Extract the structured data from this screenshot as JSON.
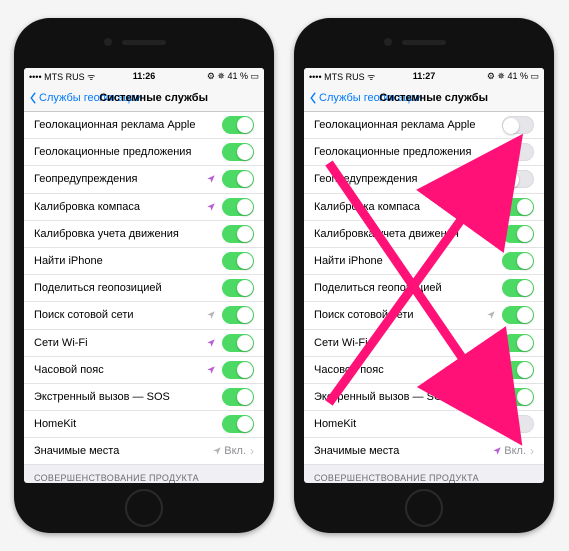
{
  "phones": [
    {
      "status": {
        "carrier": "MTS RUS",
        "sig_wifi": "📶",
        "time": "11:26",
        "bt": "⚡ ⁂",
        "battery": "41 %",
        "batt_icon": "▭"
      },
      "nav": {
        "back": "Службы геолокации",
        "title": "Системные службы"
      },
      "rows": [
        {
          "label": "Геолокационная реклама Apple",
          "toggle": true,
          "loc": null
        },
        {
          "label": "Геолокационные предложения",
          "toggle": true,
          "loc": null
        },
        {
          "label": "Геопредупреждения",
          "toggle": true,
          "loc": "purple"
        },
        {
          "label": "Калибровка компаса",
          "toggle": true,
          "loc": "purple"
        },
        {
          "label": "Калибровка учета движения",
          "toggle": true,
          "loc": null
        },
        {
          "label": "Найти iPhone",
          "toggle": true,
          "loc": null
        },
        {
          "label": "Поделиться геопозицией",
          "toggle": true,
          "loc": null
        },
        {
          "label": "Поиск сотовой сети",
          "toggle": true,
          "loc": "gray"
        },
        {
          "label": "Сети Wi-Fi",
          "toggle": true,
          "loc": "purple"
        },
        {
          "label": "Часовой пояс",
          "toggle": true,
          "loc": "purple"
        },
        {
          "label": "Экстренный вызов — SOS",
          "toggle": true,
          "loc": null
        },
        {
          "label": "HomeKit",
          "toggle": true,
          "loc": null
        }
      ],
      "link": {
        "label": "Значимые места",
        "value": "Вкл.",
        "loc": "gray"
      },
      "section": "СОВЕРШЕНСТВОВАНИЕ ПРОДУКТА"
    },
    {
      "status": {
        "carrier": "MTS RUS",
        "sig_wifi": "📶",
        "time": "11:27",
        "bt": "⚡ ⁂",
        "battery": "41 %",
        "batt_icon": "▭"
      },
      "nav": {
        "back": "Службы геолокации",
        "title": "Системные службы"
      },
      "rows": [
        {
          "label": "Геолокационная реклама Apple",
          "toggle": false,
          "loc": null
        },
        {
          "label": "Геолокационные предложения",
          "toggle": false,
          "loc": null
        },
        {
          "label": "Геопредупреждения",
          "toggle": false,
          "loc": "purple"
        },
        {
          "label": "Калибровка компаса",
          "toggle": true,
          "loc": "purple"
        },
        {
          "label": "Калибровка учета движения",
          "toggle": true,
          "loc": null
        },
        {
          "label": "Найти iPhone",
          "toggle": true,
          "loc": null
        },
        {
          "label": "Поделиться геопозицией",
          "toggle": true,
          "loc": null
        },
        {
          "label": "Поиск сотовой сети",
          "toggle": true,
          "loc": "gray"
        },
        {
          "label": "Сети Wi-Fi",
          "toggle": true,
          "loc": "purple"
        },
        {
          "label": "Часовой пояс",
          "toggle": true,
          "loc": "purple"
        },
        {
          "label": "Экстренный вызов — SOS",
          "toggle": true,
          "loc": null
        },
        {
          "label": "HomeKit",
          "toggle": false,
          "loc": null
        }
      ],
      "link": {
        "label": "Значимые места",
        "value": "Вкл.",
        "loc": "purple"
      },
      "section": "СОВЕРШЕНСТВОВАНИЕ ПРОДУКТА",
      "arrows": true
    }
  ],
  "colors": {
    "purple": "#b85fd6",
    "gray": "#b5b5ba",
    "blue": "#007aff",
    "green": "#4cd964"
  }
}
